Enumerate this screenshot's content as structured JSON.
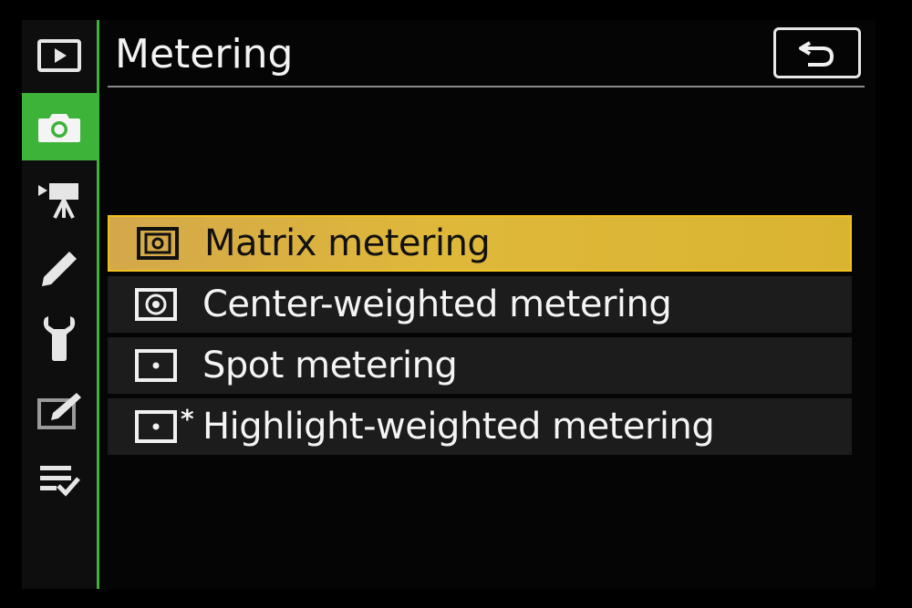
{
  "header": {
    "title": "Metering",
    "back_icon": "return-arrow-icon"
  },
  "sidebar": {
    "items": [
      {
        "name": "playback",
        "icon": "playback-icon",
        "active": false
      },
      {
        "name": "photo-shooting",
        "icon": "camera-icon",
        "active": true
      },
      {
        "name": "movie-shooting",
        "icon": "movie-camera-icon",
        "active": false
      },
      {
        "name": "custom-settings",
        "icon": "pencil-icon",
        "active": false
      },
      {
        "name": "setup",
        "icon": "wrench-icon",
        "active": false
      },
      {
        "name": "retouch",
        "icon": "retouch-icon",
        "active": false
      },
      {
        "name": "my-menu",
        "icon": "my-menu-icon",
        "active": false
      }
    ]
  },
  "menu": {
    "items": [
      {
        "label": "Matrix metering",
        "icon": "matrix-metering-icon",
        "selected": true
      },
      {
        "label": "Center-weighted metering",
        "icon": "center-weighted-metering-icon",
        "selected": false
      },
      {
        "label": "Spot metering",
        "icon": "spot-metering-icon",
        "selected": false
      },
      {
        "label": "Highlight-weighted metering",
        "icon": "highlight-weighted-metering-icon",
        "selected": false,
        "suffix": "*"
      }
    ]
  },
  "colors": {
    "accent_green": "#3db33a",
    "selection_yellow": "#dfb83a",
    "text": "#f4f4f4"
  }
}
